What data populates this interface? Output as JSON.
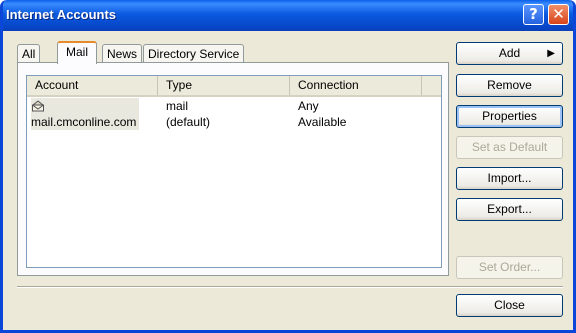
{
  "window": {
    "title": "Internet Accounts",
    "help_glyph": "?",
    "close_glyph": "✕"
  },
  "tabs": [
    {
      "label": "All"
    },
    {
      "label": "Mail"
    },
    {
      "label": "News"
    },
    {
      "label": "Directory Service"
    }
  ],
  "table": {
    "columns": [
      "Account",
      "Type",
      "Connection"
    ],
    "rows": [
      {
        "account": "mail.cmconline.com",
        "type": "mail (default)",
        "connection": "Any Available"
      }
    ]
  },
  "buttons": {
    "add": "Add",
    "remove": "Remove",
    "properties": "Properties",
    "set_default": "Set as Default",
    "import": "Import...",
    "export": "Export...",
    "set_order": "Set Order...",
    "close": "Close"
  },
  "icons": {
    "mail_account": "mail-account-icon",
    "add_arrow": "▶"
  }
}
